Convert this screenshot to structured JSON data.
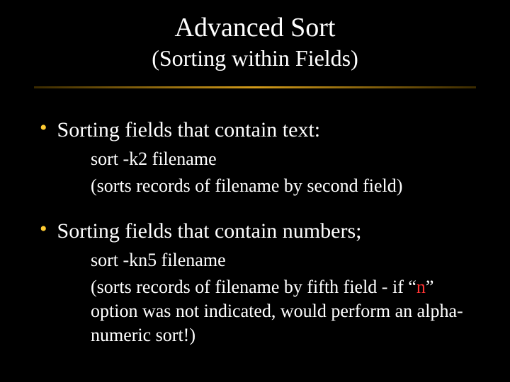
{
  "title": "Advanced Sort",
  "subtitle": "(Sorting within Fields)",
  "bullets": [
    {
      "text": "Sorting fields that contain text:",
      "sub": [
        "sort -k2 filename",
        "(sorts records of filename by second field)"
      ]
    },
    {
      "text": "Sorting fields that contain numbers;",
      "sub_parts": {
        "l1": "sort -kn5 filename",
        "l2a": "(sorts records of filename by fifth field - if “",
        "l2n": "n",
        "l2b": "” option was not indicated, would perform an alpha-numeric sort!)"
      }
    }
  ]
}
